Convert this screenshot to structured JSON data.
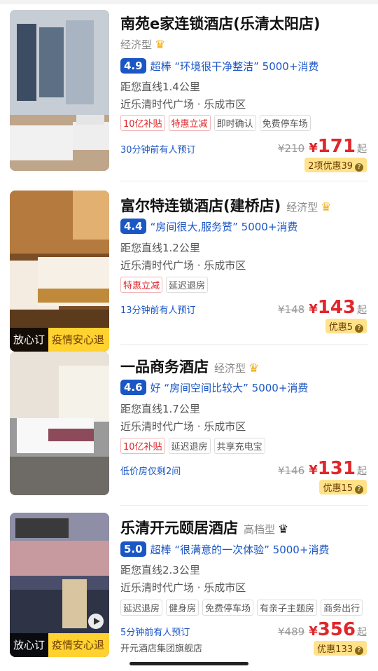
{
  "hotels": [
    {
      "name": "南苑e家连锁酒店(乐清太阳店)",
      "class": "经济型",
      "score": "4.9",
      "rating_text": "超棒 “环境很干净整洁” 5000+消费",
      "distance": "距您直线1.4公里",
      "location": "近乐清时代广场 · 乐成市区",
      "tags": [
        "10亿补贴",
        "特惠立减",
        "即时确认",
        "免费停车场"
      ],
      "note": "30分钟前有人预订",
      "orig_price": "¥210",
      "yen": "¥",
      "price": "171",
      "price_suffix": "起",
      "promo": "2项优惠39"
    },
    {
      "name": "富尔特连锁酒店(建桥店)",
      "class": "经济型",
      "score": "4.4",
      "rating_text": "“房间很大,服务赞” 5000+消费",
      "distance": "距您直线1.2公里",
      "location": "近乐清时代广场 · 乐成市区",
      "tags": [
        "特惠立减",
        "延迟退房"
      ],
      "note": "13分钟前有人预订",
      "orig_price": "¥148",
      "yen": "¥",
      "price": "143",
      "price_suffix": "起",
      "promo": "优惠5",
      "badge_a": "放心订",
      "badge_b": "疫情安心退"
    },
    {
      "name": "一品商务酒店",
      "class": "经济型",
      "score": "4.6",
      "rating_text": "好 “房间空间比较大” 5000+消费",
      "distance": "距您直线1.7公里",
      "location": "近乐清时代广场 · 乐成市区",
      "tags": [
        "10亿补贴",
        "延迟退房",
        "共享充电宝"
      ],
      "note": "低价房仅剩2间",
      "orig_price": "¥146",
      "yen": "¥",
      "price": "131",
      "price_suffix": "起",
      "promo": "优惠15"
    },
    {
      "name": "乐清开元颐居酒店",
      "class": "高档型",
      "score": "5.0",
      "rating_text": "超棒 “很满意的一次体验” 5000+消费",
      "distance": "距您直线2.3公里",
      "location": "近乐清时代广场 · 乐成市区",
      "tags": [
        "延迟退房",
        "健身房",
        "免费停车场",
        "有亲子主题房",
        "商务出行"
      ],
      "note": "5分钟前有人预订",
      "note2": "开元酒店集团旗舰店",
      "orig_price": "¥489",
      "yen": "¥",
      "price": "356",
      "price_suffix": "起",
      "promo": "优惠133",
      "badge_a": "放心订",
      "badge_b": "疫情安心退"
    }
  ],
  "colors": {
    "accent": "#1a56c4",
    "price": "#e0262b",
    "promo_bg": "#ffe28a",
    "crown": "#f2b01e"
  },
  "icons": {
    "class_icon": "crown-icon",
    "promo_icon": "question-circle-icon",
    "video_icon": "play-icon"
  }
}
